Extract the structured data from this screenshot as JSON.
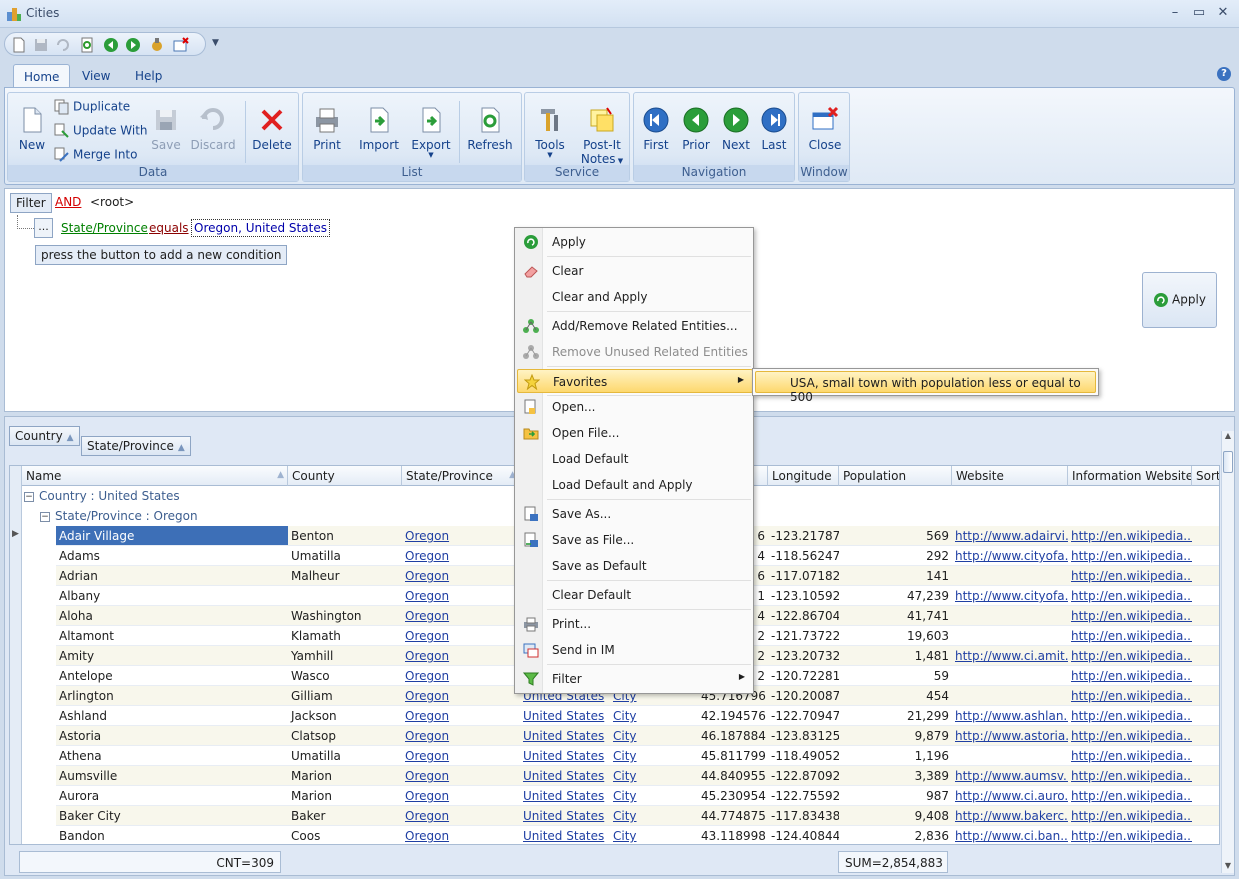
{
  "window": {
    "title": "Cities"
  },
  "tabs": [
    "Home",
    "View",
    "Help"
  ],
  "ribbon": {
    "data": {
      "label": "Data",
      "new": "New",
      "duplicate": "Duplicate",
      "update_with": "Update With",
      "merge_into": "Merge Into",
      "save": "Save",
      "discard": "Discard",
      "delete": "Delete"
    },
    "list": {
      "label": "List",
      "print": "Print",
      "import": "Import",
      "export": "Export",
      "refresh": "Refresh"
    },
    "service": {
      "label": "Service",
      "tools": "Tools",
      "postit": "Post-It",
      "notes": "Notes"
    },
    "navigation": {
      "label": "Navigation",
      "first": "First",
      "prior": "Prior",
      "next": "Next",
      "last": "Last"
    },
    "window": {
      "label": "Window",
      "close": "Close"
    }
  },
  "filter": {
    "button": "Filter",
    "operator": "AND",
    "root": "<root>",
    "dots": "...",
    "field": "State/Province",
    "condition": "equals",
    "value": "Oregon, United States",
    "hint": "press the button to add a new condition",
    "apply": "Apply"
  },
  "grouping": {
    "chip1": "Country",
    "chip2": "State/Province"
  },
  "columns": [
    "Name",
    "County",
    "State/Province",
    "Longitude",
    "Population",
    "Website",
    "Information Website",
    "Sort"
  ],
  "groups": {
    "country": "Country : United States",
    "state": "State/Province : Oregon"
  },
  "rows": [
    {
      "name": "Adair Village",
      "county": "Benton",
      "state": "Oregon",
      "country": "",
      "type": "",
      "lat": "6",
      "lon": "-123.217876",
      "pop": "569",
      "web": "http://www.adairvi...",
      "info": "http://en.wikipedia...."
    },
    {
      "name": "Adams",
      "county": "Umatilla",
      "state": "Oregon",
      "country": "",
      "type": "",
      "lat": "4",
      "lon": "-118.562473",
      "pop": "292",
      "web": "http://www.cityofa...",
      "info": "http://en.wikipedia...."
    },
    {
      "name": "Adrian",
      "county": "Malheur",
      "state": "Oregon",
      "country": "",
      "type": "",
      "lat": "6",
      "lon": "-117.071826",
      "pop": "141",
      "web": "",
      "info": "http://en.wikipedia...."
    },
    {
      "name": "Albany",
      "county": "",
      "state": "Oregon",
      "country": "",
      "type": "",
      "lat": "1",
      "lon": "-123.105928",
      "pop": "47,239",
      "web": "http://www.cityofa...",
      "info": "http://en.wikipedia...."
    },
    {
      "name": "Aloha",
      "county": "Washington",
      "state": "Oregon",
      "country": "",
      "type": "",
      "lat": "4",
      "lon": "-122.867045",
      "pop": "41,741",
      "web": "",
      "info": "http://en.wikipedia...."
    },
    {
      "name": "Altamont",
      "county": "Klamath",
      "state": "Oregon",
      "country": "",
      "type": "",
      "lat": "2",
      "lon": "-121.737224",
      "pop": "19,603",
      "web": "",
      "info": "http://en.wikipedia...."
    },
    {
      "name": "Amity",
      "county": "Yamhill",
      "state": "Oregon",
      "country": "",
      "type": "",
      "lat": "2",
      "lon": "-123.207326",
      "pop": "1,481",
      "web": "http://www.ci.amit...",
      "info": "http://en.wikipedia...."
    },
    {
      "name": "Antelope",
      "county": "Wasco",
      "state": "Oregon",
      "country": "",
      "type": "",
      "lat": "2",
      "lon": "-120.722817",
      "pop": "59",
      "web": "",
      "info": "http://en.wikipedia...."
    },
    {
      "name": "Arlington",
      "county": "Gilliam",
      "state": "Oregon",
      "country": "United States",
      "type": "City",
      "lat": "45.716796",
      "lon": "-120.200876",
      "pop": "454",
      "web": "",
      "info": "http://en.wikipedia...."
    },
    {
      "name": "Ashland",
      "county": "Jackson",
      "state": "Oregon",
      "country": "United States",
      "type": "City",
      "lat": "42.194576",
      "lon": "-122.709477",
      "pop": "21,299",
      "web": "http://www.ashlan...",
      "info": "http://en.wikipedia...."
    },
    {
      "name": "Astoria",
      "county": "Clatsop",
      "state": "Oregon",
      "country": "United States",
      "type": "City",
      "lat": "46.187884",
      "lon": "-123.831253",
      "pop": "9,879",
      "web": "http://www.astoria...",
      "info": "http://en.wikipedia...."
    },
    {
      "name": "Athena",
      "county": "Umatilla",
      "state": "Oregon",
      "country": "United States",
      "type": "City",
      "lat": "45.811799",
      "lon": "-118.490525",
      "pop": "1,196",
      "web": "",
      "info": "http://en.wikipedia...."
    },
    {
      "name": "Aumsville",
      "county": "Marion",
      "state": "Oregon",
      "country": "United States",
      "type": "City",
      "lat": "44.840955",
      "lon": "-122.870924",
      "pop": "3,389",
      "web": "http://www.aumsv...",
      "info": "http://en.wikipedia...."
    },
    {
      "name": "Aurora",
      "county": "Marion",
      "state": "Oregon",
      "country": "United States",
      "type": "City",
      "lat": "45.230954",
      "lon": "-122.755927",
      "pop": "987",
      "web": "http://www.ci.auro...",
      "info": "http://en.wikipedia...."
    },
    {
      "name": "Baker City",
      "county": "Baker",
      "state": "Oregon",
      "country": "United States",
      "type": "City",
      "lat": "44.774875",
      "lon": "-117.834385",
      "pop": "9,408",
      "web": "http://www.bakerc...",
      "info": "http://en.wikipedia...."
    },
    {
      "name": "Bandon",
      "county": "Coos",
      "state": "Oregon",
      "country": "United States",
      "type": "City",
      "lat": "43.118998",
      "lon": "-124.408448",
      "pop": "2,836",
      "web": "http://www.ci.ban...",
      "info": "http://en.wikipedia...."
    }
  ],
  "footer": {
    "count": "CNT=309",
    "sum": "SUM=2,854,883"
  },
  "context_menu": {
    "items": [
      "Apply",
      "Clear",
      "Clear and Apply",
      "Add/Remove Related Entities...",
      "Remove Unused Related Entities",
      "Favorites",
      "Open...",
      "Open File...",
      "Load Default",
      "Load Default and Apply",
      "Save As...",
      "Save as File...",
      "Save as Default",
      "Clear Default",
      "Print...",
      "Send in IM",
      "Filter"
    ],
    "favorites_sub": "USA, small town with population less or equal to 500"
  },
  "colors": {
    "accent": "#15428b",
    "link": "#1f3fa3",
    "selection": "#3d6fb7",
    "highlight": "#fdd86e"
  }
}
